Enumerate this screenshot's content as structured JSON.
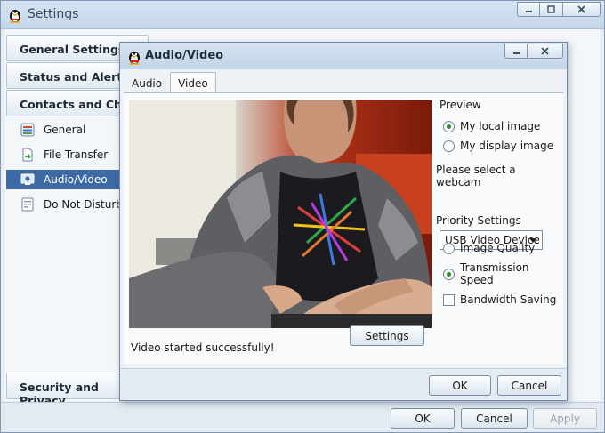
{
  "main_window": {
    "title": "Settings",
    "sections": [
      {
        "label": "General Settings"
      },
      {
        "label": "Status and Alerts"
      },
      {
        "label": "Contacts and Chat"
      }
    ],
    "nav_items": [
      {
        "label": "General",
        "icon": "settings-sliders-icon"
      },
      {
        "label": "File Transfer",
        "icon": "file-transfer-icon"
      },
      {
        "label": "Audio/Video",
        "icon": "audio-video-icon",
        "selected": true
      },
      {
        "label": "Do Not Disturb",
        "icon": "do-not-disturb-icon"
      }
    ],
    "bottom_section": {
      "label": "Security and Privacy"
    },
    "buttons": {
      "ok": "OK",
      "cancel": "Cancel",
      "apply": "Apply"
    }
  },
  "dialog": {
    "title": "Audio/Video",
    "tabs": [
      {
        "label": "Audio",
        "active": false
      },
      {
        "label": "Video",
        "active": true
      }
    ],
    "status_text": "Video started successfully!",
    "settings_button": "Settings",
    "preview": {
      "label": "Preview",
      "options": [
        {
          "label": "My local image",
          "checked": true
        },
        {
          "label": "My display image",
          "checked": false
        }
      ]
    },
    "webcam": {
      "label": "Please select a webcam",
      "selected": "USB Video Device"
    },
    "priority": {
      "label": "Priority Settings",
      "options": [
        {
          "label": "Image Quality",
          "checked": false
        },
        {
          "label": "Transmission Speed",
          "checked": true
        }
      ]
    },
    "bandwidth_saving": {
      "label": "Bandwidth Saving",
      "checked": false
    },
    "buttons": {
      "ok": "OK",
      "cancel": "Cancel"
    }
  },
  "colors": {
    "selection": "#3e6aa4",
    "title_gradient_top": "#d7e4f2",
    "radio_dot": "#2f8a2f"
  }
}
